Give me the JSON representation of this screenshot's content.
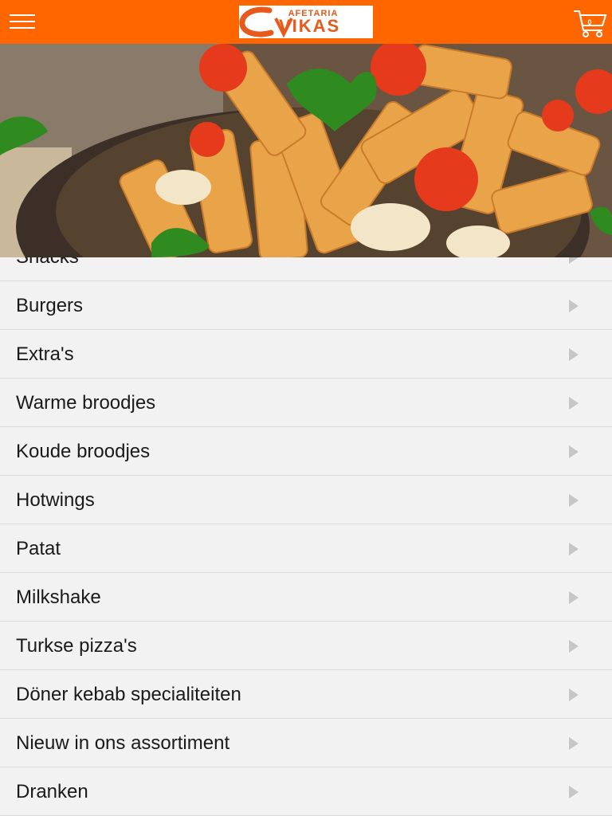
{
  "header": {
    "menu_icon": "hamburger-icon",
    "logo": {
      "top_text": "AFETARIA",
      "main_text": "VIKAS",
      "mark": "C"
    },
    "cart": {
      "icon": "cart-icon",
      "count": "0"
    },
    "colors": {
      "bar": "#ff6600",
      "logo_text": "#e85a1b"
    }
  },
  "hero": {
    "image": "pasta-dish-photo"
  },
  "menu": {
    "items": [
      {
        "label": "Snacks"
      },
      {
        "label": "Burgers"
      },
      {
        "label": "Extra's"
      },
      {
        "label": "Warme broodjes"
      },
      {
        "label": "Koude broodjes"
      },
      {
        "label": "Hotwings"
      },
      {
        "label": "Patat"
      },
      {
        "label": "Milkshake"
      },
      {
        "label": "Turkse pizza's"
      },
      {
        "label": "Döner kebab specialiteiten"
      },
      {
        "label": "Nieuw in ons assortiment"
      },
      {
        "label": "Dranken"
      }
    ],
    "arrow_icon": "chevron-right-icon"
  }
}
